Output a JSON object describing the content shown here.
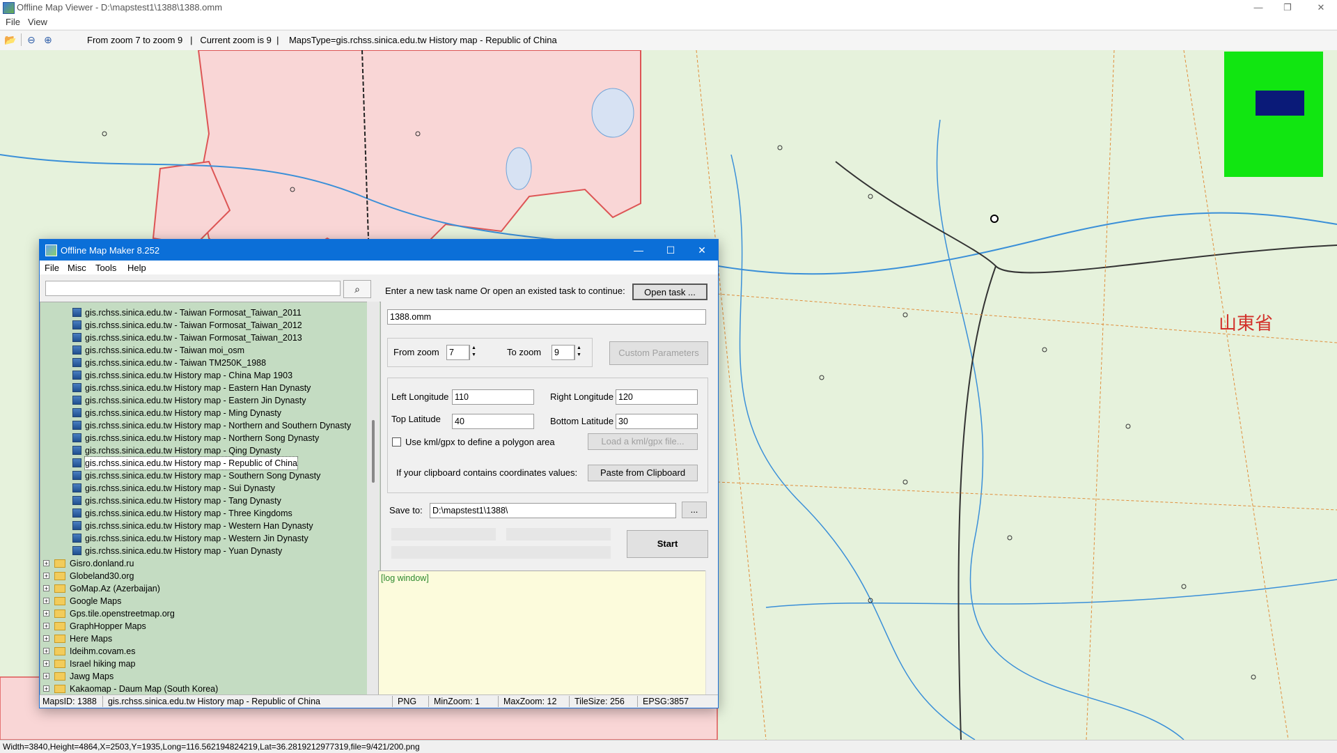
{
  "window": {
    "title": "Offline Map Viewer - D:\\mapstest1\\1388\\1388.omm",
    "controls": [
      "—",
      "❐",
      "✕"
    ]
  },
  "menu": [
    "File",
    "View"
  ],
  "toolbar": {
    "status": "From zoom 7 to zoom 9   |   Current zoom is 9  |    MapsType=gis.rchss.sinica.edu.tw History map - Republic of China"
  },
  "map": {
    "province_label": "山東省",
    "background": "#e6f2dc",
    "minimap_color": "#11e611",
    "minimap_viewport_color": "#0a1a78"
  },
  "statusbar": {
    "text": "Width=3840,Height=4864,X=2503,Y=1935,Long=116.562194824219,Lat=36.2819212977319,file=9/421/200.png"
  },
  "dialog": {
    "title": "Offline Map Maker 8.252",
    "controls": [
      "—",
      "☐",
      "✕"
    ],
    "menu": [
      "File",
      "Misc",
      "Tools",
      "Help"
    ],
    "search": {
      "value": "",
      "icon": "search-icon"
    },
    "tree_items": [
      {
        "label": "gis.rchss.sinica.edu.tw - Taiwan Formosat_Taiwan_2011",
        "type": "leaf"
      },
      {
        "label": "gis.rchss.sinica.edu.tw - Taiwan Formosat_Taiwan_2012",
        "type": "leaf"
      },
      {
        "label": "gis.rchss.sinica.edu.tw - Taiwan Formosat_Taiwan_2013",
        "type": "leaf"
      },
      {
        "label": "gis.rchss.sinica.edu.tw - Taiwan moi_osm",
        "type": "leaf"
      },
      {
        "label": "gis.rchss.sinica.edu.tw - Taiwan TM250K_1988",
        "type": "leaf"
      },
      {
        "label": "gis.rchss.sinica.edu.tw History map - China Map 1903",
        "type": "leaf"
      },
      {
        "label": "gis.rchss.sinica.edu.tw History map - Eastern Han Dynasty",
        "type": "leaf"
      },
      {
        "label": "gis.rchss.sinica.edu.tw History map - Eastern Jin Dynasty",
        "type": "leaf"
      },
      {
        "label": "gis.rchss.sinica.edu.tw History map - Ming Dynasty",
        "type": "leaf"
      },
      {
        "label": "gis.rchss.sinica.edu.tw History map - Northern and Southern Dynasty",
        "type": "leaf"
      },
      {
        "label": "gis.rchss.sinica.edu.tw History map - Northern Song Dynasty",
        "type": "leaf"
      },
      {
        "label": "gis.rchss.sinica.edu.tw History map - Qing Dynasty",
        "type": "leaf"
      },
      {
        "label": "gis.rchss.sinica.edu.tw History map - Republic of China",
        "type": "leaf",
        "selected": true
      },
      {
        "label": "gis.rchss.sinica.edu.tw History map - Southern Song Dynasty",
        "type": "leaf"
      },
      {
        "label": "gis.rchss.sinica.edu.tw History map - Sui Dynasty",
        "type": "leaf"
      },
      {
        "label": "gis.rchss.sinica.edu.tw History map - Tang Dynasty",
        "type": "leaf"
      },
      {
        "label": "gis.rchss.sinica.edu.tw History map - Three Kingdoms",
        "type": "leaf"
      },
      {
        "label": "gis.rchss.sinica.edu.tw History map - Western Han Dynasty",
        "type": "leaf"
      },
      {
        "label": "gis.rchss.sinica.edu.tw History map - Western Jin Dynasty",
        "type": "leaf"
      },
      {
        "label": "gis.rchss.sinica.edu.tw History map - Yuan Dynasty",
        "type": "leaf"
      },
      {
        "label": "Gisro.donland.ru",
        "type": "folder"
      },
      {
        "label": "Globeland30.org",
        "type": "folder"
      },
      {
        "label": "GoMap.Az (Azerbaijan)",
        "type": "folder"
      },
      {
        "label": "Google Maps",
        "type": "folder"
      },
      {
        "label": "Gps.tile.openstreetmap.org",
        "type": "folder"
      },
      {
        "label": "GraphHopper Maps",
        "type": "folder"
      },
      {
        "label": "Here Maps",
        "type": "folder"
      },
      {
        "label": "Ideihm.covam.es",
        "type": "folder"
      },
      {
        "label": "Israel hiking map",
        "type": "folder"
      },
      {
        "label": "Jawg Maps",
        "type": "folder"
      },
      {
        "label": "Kakaomap - Daum Map (South Korea)",
        "type": "folder"
      }
    ],
    "form": {
      "task_prompt": "Enter a new task name Or open an existed task to continue:",
      "open_task": "Open task ...",
      "task_name": "1388.omm",
      "from_zoom_label": "From zoom",
      "from_zoom": "7",
      "to_zoom_label": "To zoom",
      "to_zoom": "9",
      "custom_params": "Custom Parameters",
      "left_lon_label": "Left Longitude",
      "left_lon": "110",
      "right_lon_label": "Right Longitude",
      "right_lon": "120",
      "top_lat_label": "Top Latitude",
      "top_lat": "40",
      "bottom_lat_label": "Bottom Latitude",
      "bottom_lat": "30",
      "kml_label": "Use kml/gpx to define a polygon area",
      "kml_button": "Load a kml/gpx file...",
      "clipboard_label": "If your clipboard contains coordinates values:",
      "clipboard_button": "Paste from Clipboard",
      "save_label": "Save to:",
      "save_path": "D:\\mapstest1\\1388\\",
      "browse": "...",
      "start": "Start",
      "log": "[log window]"
    },
    "status": {
      "maps_id": "MapsID: 1388",
      "maps_name": "gis.rchss.sinica.edu.tw History map - Republic of China",
      "format": "PNG",
      "min_zoom": "MinZoom: 1",
      "max_zoom": "MaxZoom: 12",
      "tile_size": "TileSize: 256",
      "epsg": "EPSG:3857"
    }
  }
}
